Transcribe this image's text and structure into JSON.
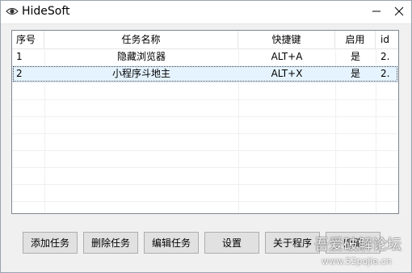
{
  "window": {
    "title": "HideSoft",
    "icon": "eye-icon"
  },
  "list": {
    "columns": [
      "序号",
      "任务名称",
      "快捷键",
      "启用",
      "id"
    ],
    "rows": [
      {
        "index": "1",
        "name": "隐藏浏览器",
        "hotkey": "ALT+A",
        "enabled": "是",
        "id": "2."
      },
      {
        "index": "2",
        "name": "小程序斗地主",
        "hotkey": "ALT+X",
        "enabled": "是",
        "id": "2."
      }
    ],
    "selected_row": 2
  },
  "buttons": {
    "add": "添加任务",
    "delete": "删除任务",
    "edit": "编辑任务",
    "settings": "设置",
    "about": "关于程序",
    "hide": "隐藏"
  },
  "watermark": {
    "text": "吾爱破解论坛",
    "url": "www.52pojie.cn"
  },
  "colors": {
    "selection": "#e5f3ff",
    "button_face": "#e1e1e1"
  }
}
